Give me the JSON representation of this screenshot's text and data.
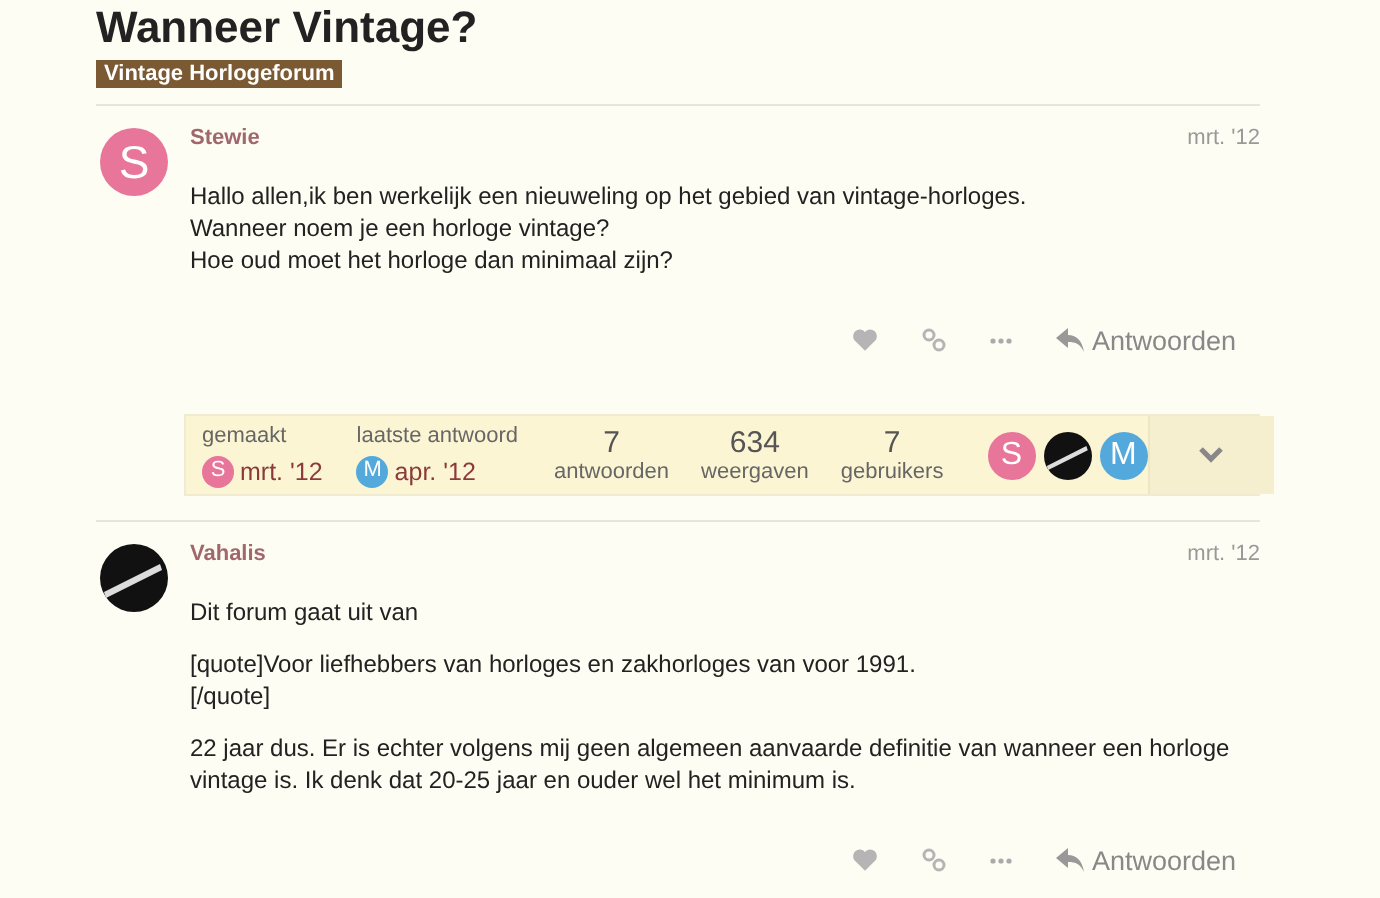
{
  "title": "Wanneer Vintage?",
  "category": {
    "label": "Vintage Horlogeforum",
    "color": "#7b5a33"
  },
  "posts": [
    {
      "author": "Stewie",
      "avatar": {
        "kind": "letter",
        "letter": "S",
        "color": "#e8759a"
      },
      "date": "mrt. '12",
      "paragraphs": [
        "Hallo allen,ik ben werkelijk een nieuweling op het gebied van vintage-horloges.\nWanneer noem je een horloge vintage?\nHoe oud moet het horloge dan minimaal zijn?"
      ],
      "reply": "Antwoorden"
    },
    {
      "author": "Vahalis",
      "avatar": {
        "kind": "picture"
      },
      "date": "mrt. '12",
      "paragraphs": [
        "Dit forum gaat uit van",
        "[quote]Voor liefhebbers van horloges en zakhorloges van voor 1991.\n[/quote]",
        "22 jaar dus. Er is echter volgens mij geen algemeen aanvaarde definitie van wanneer een horloge vintage is. Ik denk dat 20-25 jaar en ouder wel het minimum is."
      ],
      "reply": "Antwoorden"
    }
  ],
  "topic_map": {
    "created": {
      "label": "gemaakt",
      "avatar": {
        "kind": "letter",
        "letter": "S",
        "color": "#e8759a"
      },
      "date": "mrt. '12"
    },
    "last_reply": {
      "label": "laatste antwoord",
      "avatar": {
        "kind": "letter",
        "letter": "M",
        "color": "#53a8dc"
      },
      "date": "apr. '12"
    },
    "stats": [
      {
        "value": "7",
        "label": "antwoorden"
      },
      {
        "value": "634",
        "label": "weergaven"
      },
      {
        "value": "7",
        "label": "gebruikers"
      }
    ],
    "participants": [
      {
        "kind": "letter",
        "letter": "S",
        "color": "#e8759a"
      },
      {
        "kind": "picture"
      },
      {
        "kind": "letter",
        "letter": "M",
        "color": "#53a8dc"
      }
    ],
    "expanded": false
  }
}
